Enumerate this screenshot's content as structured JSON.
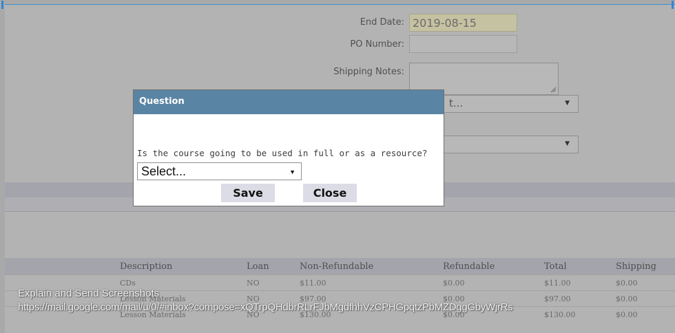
{
  "form": {
    "end_date_label": "End Date:",
    "end_date_value": "2019-08-15",
    "po_number_label": "PO Number:",
    "po_number_value": "",
    "shipping_notes_label": "Shipping Notes:",
    "shipping_notes_value": "",
    "select_1_visible_text": "t...",
    "select_2_visible_text": ""
  },
  "dialog": {
    "title": "Question",
    "question": "Is the course going to be used in full or as a resource?",
    "select_value": "Select...",
    "save_label": "Save",
    "close_label": "Close"
  },
  "table": {
    "headers": [
      "Description",
      "Loan",
      "Non-Refundable",
      "Refundable",
      "Total",
      "Shipping"
    ],
    "rows": [
      [
        "CDs",
        "NO",
        "$11.00",
        "$0.00",
        "$11.00",
        "$0.00"
      ],
      [
        "Lesson Materials",
        "NO",
        "$97.00",
        "$0.00",
        "$97.00",
        "$0.00"
      ],
      [
        "Lesson Materials",
        "NO",
        "$130.00",
        "$0.00",
        "$130.00",
        "$0.00"
      ]
    ]
  },
  "overlay": {
    "line1": "Explain and Send Screenshots",
    "line2": "https://mail.google.com/mail/u/0/#inbox?compose=xQTrpQHdbrRLrFJbMgdfhhVzCPHGpqtzPbMZDggGbyWjrRs"
  },
  "colors": {
    "dialog_title_bg": "#5a84a3",
    "page_bg": "#b3b3b3",
    "highlight_field": "#c5c2a2",
    "button_bg": "#dcdce6"
  },
  "icons": {
    "select_arrow": "arrow-down-icon",
    "resize_grip": "resize-grip-icon"
  }
}
